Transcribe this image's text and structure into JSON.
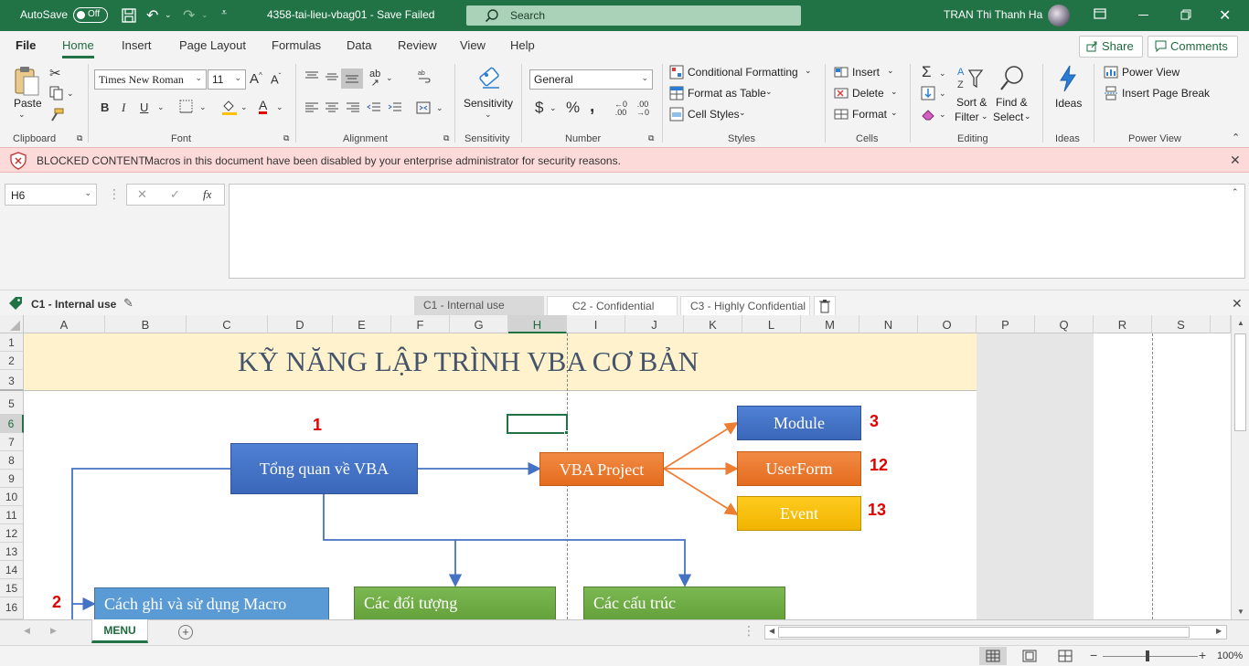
{
  "titlebar": {
    "autosave_label": "AutoSave",
    "autosave_state": "Off",
    "doc_title": "4358-tai-lieu-vbag01  -  Save Failed",
    "search_placeholder": "Search",
    "user_name": "TRAN Thi Thanh Ha"
  },
  "menu": {
    "tabs": [
      "File",
      "Home",
      "Insert",
      "Page Layout",
      "Formulas",
      "Data",
      "Review",
      "View",
      "Help"
    ],
    "active": "Home",
    "share_label": "Share",
    "comments_label": "Comments"
  },
  "ribbon": {
    "clipboard": {
      "paste_label": "Paste",
      "group_label": "Clipboard"
    },
    "font": {
      "font_name": "Times New Roman",
      "font_size": "11",
      "group_label": "Font"
    },
    "alignment": {
      "group_label": "Alignment"
    },
    "sensitivity": {
      "label": "Sensitivity",
      "group_label": "Sensitivity"
    },
    "number": {
      "format": "General",
      "group_label": "Number"
    },
    "styles": {
      "conditional": "Conditional Formatting",
      "format_table": "Format as Table",
      "cell_styles": "Cell Styles",
      "group_label": "Styles"
    },
    "cells": {
      "insert": "Insert",
      "delete": "Delete",
      "format": "Format",
      "group_label": "Cells"
    },
    "editing": {
      "sort_line1": "Sort &",
      "sort_line2": "Filter",
      "find_line1": "Find &",
      "find_line2": "Select",
      "group_label": "Editing"
    },
    "ideas": {
      "label": "Ideas",
      "group_label": "Ideas"
    },
    "powerview": {
      "power_view": "Power View",
      "insert_break": "Insert Page Break",
      "group_label": "Power View"
    }
  },
  "blocked": {
    "title": "BLOCKED CONTENT",
    "message": "Macros in this document have been disabled by your enterprise administrator for security reasons."
  },
  "formula": {
    "name_box": "H6",
    "fx": "fx"
  },
  "sensitivity_bar": {
    "current": "C1 - Internal use",
    "options": [
      "C1 - Internal use",
      "C2 - Confidential",
      "C3 - Highly Confidential"
    ]
  },
  "grid": {
    "columns": [
      "A",
      "B",
      "C",
      "D",
      "E",
      "F",
      "G",
      "H",
      "I",
      "J",
      "K",
      "L",
      "M",
      "N",
      "O",
      "P",
      "Q",
      "R",
      "S"
    ],
    "rows": [
      "1",
      "2",
      "3",
      "5",
      "6",
      "7",
      "8",
      "9",
      "10",
      "11",
      "12",
      "13",
      "14",
      "15",
      "16"
    ],
    "selected_col": "H",
    "selected_row": "6"
  },
  "diagram": {
    "title": "KỸ NĂNG LẬP TRÌNH VBA CƠ BẢN",
    "tong_quan": "Tổng quan về VBA",
    "vba_project": "VBA Project",
    "module": "Module",
    "userform": "UserForm",
    "event": "Event",
    "cach_ghi": "Cách ghi và sử dụng Macro",
    "doi_tuong": "Các đối tượng",
    "cau_truc": "Các cấu trúc",
    "n1": "1",
    "n2": "2",
    "n3": "3",
    "n12": "12",
    "n13": "13"
  },
  "sheets": {
    "active": "MENU"
  },
  "status": {
    "zoom": "100%"
  },
  "colors": {
    "excel_green": "#217346",
    "blue_box": "#4472c4",
    "orange_box": "#ed7d31",
    "yellow_box": "#ffc000",
    "green_box": "#70ad47"
  }
}
